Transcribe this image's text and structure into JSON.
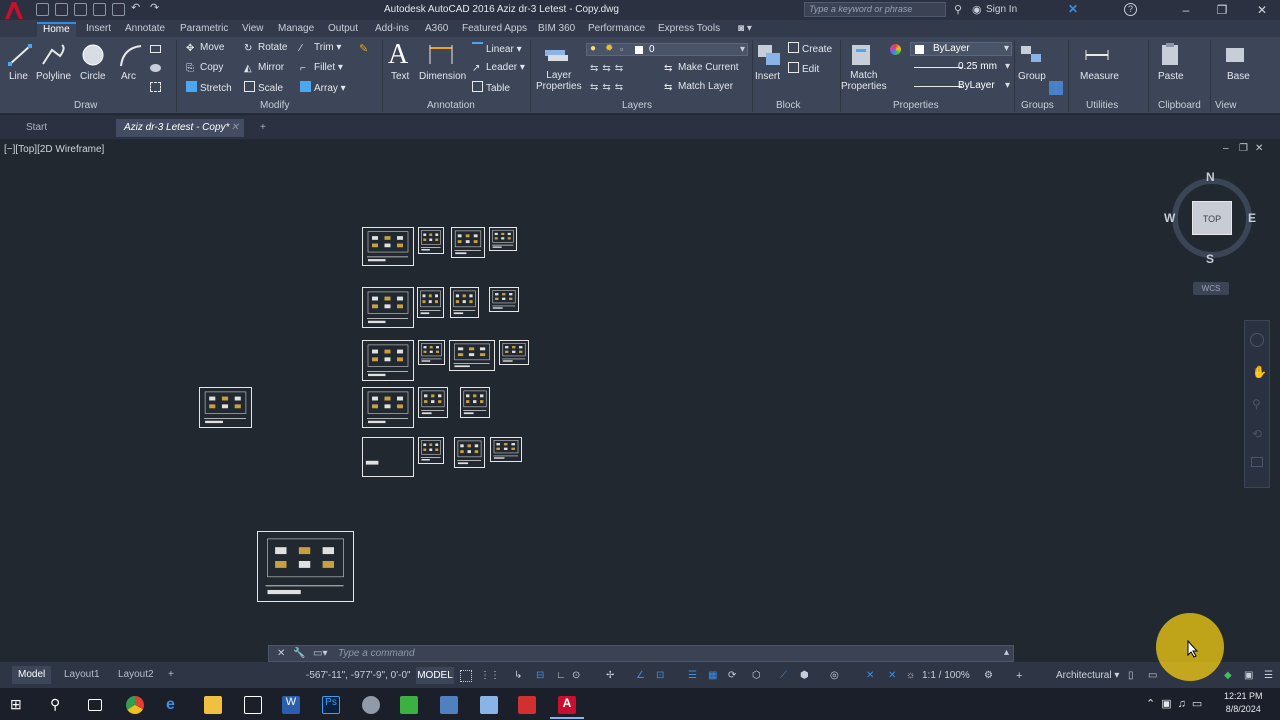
{
  "titlebar": {
    "title": "Autodesk AutoCAD 2016    Aziz dr-3 Letest - Copy.dwg",
    "search_placeholder": "Type a keyword or phrase",
    "sign_in": "Sign In"
  },
  "ribbon_tabs": [
    "Home",
    "Insert",
    "Annotate",
    "Parametric",
    "View",
    "Manage",
    "Output",
    "Add-ins",
    "A360",
    "Featured Apps",
    "BIM 360",
    "Performance",
    "Express Tools"
  ],
  "ribbon": {
    "draw": {
      "line": "Line",
      "polyline": "Polyline",
      "circle": "Circle",
      "arc": "Arc",
      "panel": "Draw"
    },
    "modify": {
      "move": "Move",
      "rotate": "Rotate",
      "trim": "Trim",
      "copy": "Copy",
      "mirror": "Mirror",
      "fillet": "Fillet",
      "stretch": "Stretch",
      "scale": "Scale",
      "array": "Array",
      "panel": "Modify"
    },
    "annotation": {
      "text": "Text",
      "dimension": "Dimension",
      "linear": "Linear",
      "leader": "Leader",
      "table": "Table",
      "panel": "Annotation"
    },
    "layers": {
      "layer_properties_1": "Layer",
      "layer_properties_2": "Properties",
      "current_layer": "0",
      "make_current": "Make Current",
      "match_layer": "Match Layer",
      "panel": "Layers"
    },
    "block": {
      "insert": "Insert",
      "create": "Create",
      "edit": "Edit",
      "panel": "Block"
    },
    "properties": {
      "match_1": "Match",
      "match_2": "Properties",
      "color": "ByLayer",
      "lineweight": "0.25 mm",
      "linetype": "ByLayer",
      "panel": "Properties"
    },
    "groups": {
      "group": "Group",
      "panel": "Groups"
    },
    "utilities": {
      "measure": "Measure",
      "panel": "Utilities"
    },
    "clipboard": {
      "paste": "Paste",
      "panel": "Clipboard"
    },
    "view": {
      "base": "Base",
      "panel": "View"
    }
  },
  "doc_tabs": {
    "start": "Start",
    "active": "Aziz dr-3 Letest - Copy*"
  },
  "viewport": {
    "label": "[−][Top][2D Wireframe]",
    "viewcube": {
      "n": "N",
      "s": "S",
      "e": "E",
      "w": "W",
      "face": "TOP",
      "wcs": "WCS"
    }
  },
  "command": {
    "placeholder": "Type  a  command"
  },
  "layout_tabs": [
    "Model",
    "Layout1",
    "Layout2"
  ],
  "status": {
    "coords": "-567'-11\", -977'-9\", 0'-0\"",
    "model": "MODEL",
    "scale": "1:1 / 100%",
    "units": "Architectural"
  },
  "taskbar": {
    "time": "12:21 PM",
    "date": "8/8/2024"
  },
  "colors": {
    "accent": "#2e8de8",
    "background": "#212830",
    "logo_red": "#c8102e",
    "cursor_highlight": "#ecc814"
  }
}
